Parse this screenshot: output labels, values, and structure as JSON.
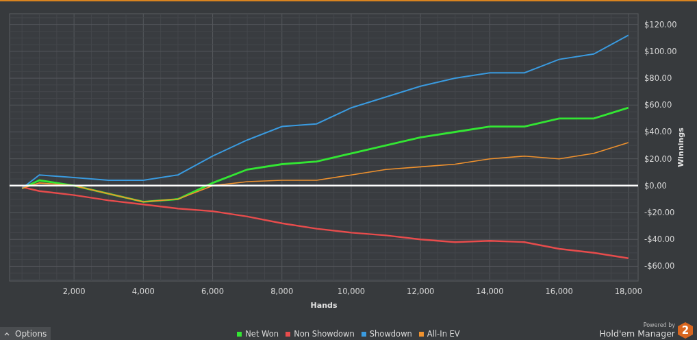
{
  "chart_data": {
    "type": "line",
    "xlabel": "Hands",
    "ylabel": "Winnings",
    "x": [
      500,
      1000,
      2000,
      3000,
      4000,
      5000,
      6000,
      7000,
      8000,
      9000,
      10000,
      11000,
      12000,
      13000,
      14000,
      15000,
      16000,
      17000,
      18000
    ],
    "series": [
      {
        "name": "Net Won",
        "color": "#33e633",
        "values": [
          -2,
          4,
          0,
          -6,
          -12,
          -10,
          2,
          12,
          16,
          18,
          24,
          30,
          36,
          40,
          44,
          44,
          50,
          50,
          58
        ]
      },
      {
        "name": "Non Showdown",
        "color": "#e84c4c",
        "values": [
          -1,
          -4,
          -7,
          -11,
          -14,
          -17,
          -19,
          -23,
          -28,
          -32,
          -35,
          -37,
          -40,
          -42,
          -41,
          -42,
          -47,
          -50,
          -54
        ]
      },
      {
        "name": "Showdown",
        "color": "#3a9be0",
        "values": [
          -2,
          8,
          6,
          4,
          4,
          8,
          22,
          34,
          44,
          46,
          58,
          66,
          74,
          80,
          84,
          84,
          94,
          98,
          112
        ]
      },
      {
        "name": "All-In EV",
        "color": "#f0922e",
        "values": [
          -2,
          2,
          0,
          -6,
          -12,
          -10,
          0,
          3,
          4,
          4,
          8,
          12,
          14,
          16,
          20,
          22,
          20,
          24,
          32
        ]
      }
    ],
    "xlim": [
      140,
      18280
    ],
    "ylim": [
      -71,
      128
    ],
    "xticks": [
      {
        "value": 2000,
        "label": "2,000"
      },
      {
        "value": 4000,
        "label": "4,000"
      },
      {
        "value": 6000,
        "label": "6,000"
      },
      {
        "value": 8000,
        "label": "8,000"
      },
      {
        "value": 10000,
        "label": "10,000"
      },
      {
        "value": 12000,
        "label": "12,000"
      },
      {
        "value": 14000,
        "label": "14,000"
      },
      {
        "value": 16000,
        "label": "16,000"
      },
      {
        "value": 18000,
        "label": "18,000"
      }
    ],
    "yticks": [
      {
        "value": 120,
        "label": "$120.00"
      },
      {
        "value": 100,
        "label": "$100.00"
      },
      {
        "value": 80,
        "label": "$80.00"
      },
      {
        "value": 60,
        "label": "$60.00"
      },
      {
        "value": 40,
        "label": "$40.00"
      },
      {
        "value": 20,
        "label": "$20.00"
      },
      {
        "value": 0,
        "label": "$0.00"
      },
      {
        "value": -20,
        "label": "-$20.00"
      },
      {
        "value": -40,
        "label": "-$40.00"
      },
      {
        "value": -60,
        "label": "-$60.00"
      }
    ],
    "grid": true,
    "ref_lines": [
      {
        "axis": "y",
        "value": 0
      }
    ]
  },
  "options_button": {
    "label": "Options"
  },
  "branding": {
    "caption": "Powered by",
    "product": "Hold'em Manager",
    "badge": "2"
  }
}
